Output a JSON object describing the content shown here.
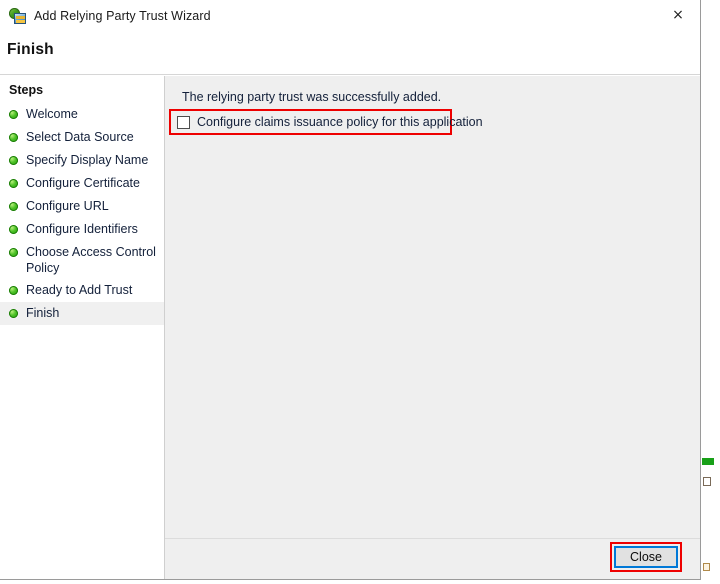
{
  "window": {
    "title": "Add Relying Party Trust Wizard",
    "icon": "relying-party-trust-icon",
    "close_glyph": "×"
  },
  "page": {
    "heading": "Finish"
  },
  "sidebar": {
    "heading": "Steps",
    "items": [
      {
        "label": "Welcome",
        "status_icon": "green-bullet-icon",
        "current": false
      },
      {
        "label": "Select Data Source",
        "status_icon": "green-bullet-icon",
        "current": false
      },
      {
        "label": "Specify Display Name",
        "status_icon": "green-bullet-icon",
        "current": false
      },
      {
        "label": "Configure Certificate",
        "status_icon": "green-bullet-icon",
        "current": false
      },
      {
        "label": "Configure URL",
        "status_icon": "green-bullet-icon",
        "current": false
      },
      {
        "label": "Configure Identifiers",
        "status_icon": "green-bullet-icon",
        "current": false
      },
      {
        "label": "Choose Access Control Policy",
        "status_icon": "green-bullet-icon",
        "current": false
      },
      {
        "label": "Ready to Add Trust",
        "status_icon": "green-bullet-icon",
        "current": false
      },
      {
        "label": "Finish",
        "status_icon": "green-bullet-icon",
        "current": true
      }
    ]
  },
  "content": {
    "success_message": "The relying party trust was successfully added.",
    "claims_policy_checkbox": {
      "label": "Configure claims issuance policy for this application",
      "checked": false
    }
  },
  "footer": {
    "close_label": "Close"
  },
  "colors": {
    "highlight_outline": "#ee0000",
    "focus_border": "#0078d7",
    "step_bullet_green": "#4ec228",
    "content_background": "#efefef",
    "desktop_green_mark": "#18a018"
  }
}
